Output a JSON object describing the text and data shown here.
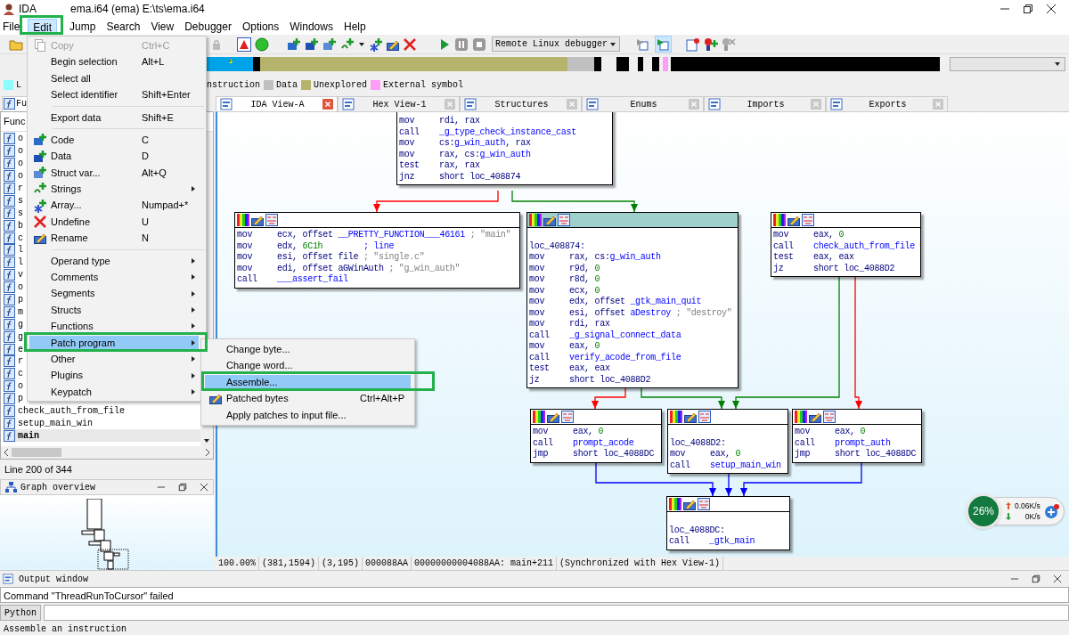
{
  "window": {
    "app": "IDA",
    "title": "ema.i64 (ema) E:\\ts\\ema.i64"
  },
  "menu_bar": [
    {
      "label": "File",
      "selected": false
    },
    {
      "label": "Edit",
      "selected": true
    },
    {
      "label": "Jump",
      "selected": false
    },
    {
      "label": "Search",
      "selected": false
    },
    {
      "label": "View",
      "selected": false
    },
    {
      "label": "Debugger",
      "selected": false
    },
    {
      "label": "Options",
      "selected": false
    },
    {
      "label": "Windows",
      "selected": false
    },
    {
      "label": "Help",
      "selected": false
    }
  ],
  "toolbar": {
    "debugger": "Remote Linux debugger",
    "toggles": [
      {
        "selected": false
      },
      {
        "selected": true
      }
    ]
  },
  "legend": [
    {
      "label": "L",
      "color": "#8cfcfc"
    },
    {
      "label": "nstruction"
    },
    {
      "label": "Data",
      "color": "#c0c0c0"
    },
    {
      "label": "Unexplored",
      "color": "#b5b36c"
    },
    {
      "label": "External symbol",
      "color": "#ff9cf5"
    }
  ],
  "left_panel": {
    "tab": "Fu",
    "column": "Func",
    "line_info": "Line 200 of 344",
    "overview_title": "Graph overview",
    "functions": [
      {
        "name": "o",
        "selected": false
      },
      {
        "name": "o",
        "selected": false
      },
      {
        "name": "o",
        "selected": false
      },
      {
        "name": "o",
        "selected": false
      },
      {
        "name": "r",
        "selected": false
      },
      {
        "name": "s",
        "selected": false
      },
      {
        "name": "s",
        "selected": false
      },
      {
        "name": "b",
        "selected": false
      },
      {
        "name": "c",
        "selected": false
      },
      {
        "name": "l",
        "selected": false
      },
      {
        "name": "l",
        "selected": false
      },
      {
        "name": "v",
        "selected": false
      },
      {
        "name": "o",
        "selected": false
      },
      {
        "name": "p",
        "selected": false
      },
      {
        "name": "m",
        "selected": false
      },
      {
        "name": "g",
        "selected": false
      },
      {
        "name": "g",
        "selected": false
      },
      {
        "name": "e",
        "selected": false
      },
      {
        "name": "r",
        "selected": false
      },
      {
        "name": "c",
        "selected": false
      },
      {
        "name": "o",
        "selected": false
      },
      {
        "name": "p",
        "selected": false
      },
      {
        "name": "check_auth_from_file",
        "selected": false
      },
      {
        "name": "setup_main_win",
        "selected": false
      },
      {
        "name": "main",
        "selected": true
      }
    ]
  },
  "tabs": [
    {
      "label": "IDA View-A",
      "selected": true
    },
    {
      "label": "Hex View-1",
      "selected": false
    },
    {
      "label": "Structures",
      "selected": false
    },
    {
      "label": "Enums",
      "selected": false
    },
    {
      "label": "Imports",
      "selected": false
    },
    {
      "label": "Exports",
      "selected": false
    }
  ],
  "graph": {
    "nodes": [
      {
        "lines": [
          {
            "op": "mov",
            "args": [
              {
                "text": "rdi, rax",
                "kind": "reg"
              }
            ]
          },
          {
            "op": "call",
            "args": [
              {
                "text": "_g_type_check_instance_cast",
                "kind": "name"
              }
            ]
          },
          {
            "op": "mov",
            "args": [
              {
                "text": "cs:",
                "kind": "reg"
              },
              {
                "text": "g_win_auth",
                "kind": "name"
              },
              {
                "text": ", rax",
                "kind": "reg"
              }
            ]
          },
          {
            "op": "mov",
            "args": [
              {
                "text": "rax, cs:",
                "kind": "reg"
              },
              {
                "text": "g_win_auth",
                "kind": "name"
              }
            ]
          },
          {
            "op": "test",
            "args": [
              {
                "text": "rax, rax",
                "kind": "reg"
              }
            ]
          },
          {
            "op": "jnz",
            "args": [
              {
                "text": "short loc_408874",
                "kind": "reg"
              }
            ]
          }
        ]
      },
      {
        "selected": false,
        "lines": [
          {
            "op": "mov",
            "args": [
              {
                "text": "ecx, offset ",
                "kind": "reg"
              },
              {
                "text": "__PRETTY_FUNCTION___46161",
                "kind": "name"
              },
              {
                "text": " ; \"main\"",
                "kind": "comment"
              }
            ]
          },
          {
            "op": "mov",
            "args": [
              {
                "text": "edx, ",
                "kind": "reg"
              },
              {
                "text": "6C1h",
                "kind": "num"
              },
              {
                "text": "        ; line",
                "kind": "name"
              }
            ]
          },
          {
            "op": "mov",
            "args": [
              {
                "text": "esi, offset file ",
                "kind": "reg"
              },
              {
                "text": "; \"single.c\"",
                "kind": "comment"
              }
            ]
          },
          {
            "op": "mov",
            "args": [
              {
                "text": "edi, offset aGWinAuth ",
                "kind": "reg"
              },
              {
                "text": "; \"g_win_auth\"",
                "kind": "comment"
              }
            ]
          },
          {
            "op": "call",
            "args": [
              {
                "text": "___assert_fail",
                "kind": "name"
              }
            ]
          }
        ]
      },
      {
        "selected": true,
        "label": "loc_408874:",
        "lines": [
          {
            "op": "mov",
            "args": [
              {
                "text": "rax, cs:",
                "kind": "reg"
              },
              {
                "text": "g_win_auth",
                "kind": "name"
              }
            ]
          },
          {
            "op": "mov",
            "args": [
              {
                "text": "r9d, ",
                "kind": "reg"
              },
              {
                "text": "0",
                "kind": "num"
              }
            ]
          },
          {
            "op": "mov",
            "args": [
              {
                "text": "r8d, ",
                "kind": "reg"
              },
              {
                "text": "0",
                "kind": "num"
              }
            ]
          },
          {
            "op": "mov",
            "args": [
              {
                "text": "ecx, ",
                "kind": "reg"
              },
              {
                "text": "0",
                "kind": "num"
              }
            ]
          },
          {
            "op": "mov",
            "args": [
              {
                "text": "edx, offset ",
                "kind": "reg"
              },
              {
                "text": "_gtk_main_quit",
                "kind": "name"
              }
            ]
          },
          {
            "op": "mov",
            "args": [
              {
                "text": "esi, offset ",
                "kind": "reg"
              },
              {
                "text": "aDestroy",
                "kind": "name"
              },
              {
                "text": " ; \"destroy\"",
                "kind": "comment"
              }
            ]
          },
          {
            "op": "mov",
            "args": [
              {
                "text": "rdi, rax",
                "kind": "reg"
              }
            ]
          },
          {
            "op": "call",
            "args": [
              {
                "text": "_g_signal_connect_data",
                "kind": "name"
              }
            ]
          },
          {
            "op": "mov",
            "args": [
              {
                "text": "eax, ",
                "kind": "reg"
              },
              {
                "text": "0",
                "kind": "num"
              }
            ]
          },
          {
            "op": "call",
            "args": [
              {
                "text": "verify_acode_from_file",
                "kind": "name"
              }
            ]
          },
          {
            "op": "test",
            "args": [
              {
                "text": "eax, eax",
                "kind": "reg"
              }
            ]
          },
          {
            "op": "jz",
            "args": [
              {
                "text": "short loc_4088D2",
                "kind": "reg"
              }
            ]
          }
        ]
      },
      {
        "selected": false,
        "lines": [
          {
            "op": "mov",
            "args": [
              {
                "text": "eax, ",
                "kind": "reg"
              },
              {
                "text": "0",
                "kind": "num"
              }
            ]
          },
          {
            "op": "call",
            "args": [
              {
                "text": "check_auth_from_file",
                "kind": "name"
              }
            ]
          },
          {
            "op": "test",
            "args": [
              {
                "text": "eax, eax",
                "kind": "reg"
              }
            ]
          },
          {
            "op": "jz",
            "args": [
              {
                "text": "short loc_4088D2",
                "kind": "reg"
              }
            ]
          }
        ]
      },
      {
        "selected": false,
        "lines": [
          {
            "op": "mov",
            "args": [
              {
                "text": "eax, ",
                "kind": "reg"
              },
              {
                "text": "0",
                "kind": "num"
              }
            ]
          },
          {
            "op": "call",
            "args": [
              {
                "text": "prompt_acode",
                "kind": "name"
              }
            ]
          },
          {
            "op": "jmp",
            "args": [
              {
                "text": "short loc_4088DC",
                "kind": "reg"
              }
            ]
          }
        ]
      },
      {
        "selected": false,
        "label": "loc_4088D2:",
        "lines": [
          {
            "op": "mov",
            "args": [
              {
                "text": "eax, ",
                "kind": "reg"
              },
              {
                "text": "0",
                "kind": "num"
              }
            ]
          },
          {
            "op": "call",
            "args": [
              {
                "text": "setup_main_win",
                "kind": "name"
              }
            ]
          }
        ]
      },
      {
        "selected": false,
        "lines": [
          {
            "op": "mov",
            "args": [
              {
                "text": "eax, ",
                "kind": "reg"
              },
              {
                "text": "0",
                "kind": "num"
              }
            ]
          },
          {
            "op": "call",
            "args": [
              {
                "text": "prompt_auth",
                "kind": "name"
              }
            ]
          },
          {
            "op": "jmp",
            "args": [
              {
                "text": "short loc_4088DC",
                "kind": "reg"
              }
            ]
          }
        ]
      },
      {
        "selected": false,
        "label": "loc_4088DC:",
        "lines": [
          {
            "op": "call",
            "args": [
              {
                "text": "_gtk_main",
                "kind": "name"
              }
            ]
          }
        ]
      }
    ]
  },
  "graph_status": [
    "100.00%",
    "(381,1594)",
    "(3,195)",
    "000088AA",
    "00000000004088AA: main+211",
    "(Synchronized with Hex View-1)"
  ],
  "edit_menu": [
    {
      "kind": "item",
      "label": "Copy",
      "shortcut": "Ctrl+C",
      "disabled": true,
      "selected": false,
      "submenu": false
    },
    {
      "kind": "item",
      "label": "Begin selection",
      "shortcut": "Alt+L",
      "disabled": false,
      "selected": false,
      "submenu": false
    },
    {
      "kind": "item",
      "label": "Select all",
      "disabled": false,
      "selected": false,
      "submenu": false
    },
    {
      "kind": "item",
      "label": "Select identifier",
      "shortcut": "Shift+Enter",
      "disabled": false,
      "selected": false,
      "submenu": false
    },
    {
      "kind": "separator"
    },
    {
      "kind": "item",
      "label": "Export data",
      "shortcut": "Shift+E",
      "disabled": false,
      "selected": false,
      "submenu": false
    },
    {
      "kind": "separator"
    },
    {
      "kind": "item",
      "label": "Code",
      "shortcut": "C",
      "disabled": false,
      "selected": false,
      "submenu": false
    },
    {
      "kind": "item",
      "label": "Data",
      "shortcut": "D",
      "disabled": false,
      "selected": false,
      "submenu": false
    },
    {
      "kind": "item",
      "label": "Struct var...",
      "shortcut": "Alt+Q",
      "disabled": false,
      "selected": false,
      "submenu": false
    },
    {
      "kind": "item",
      "label": "Strings",
      "disabled": false,
      "selected": false,
      "submenu": true
    },
    {
      "kind": "item",
      "label": "Array...",
      "shortcut": "Numpad+*",
      "disabled": false,
      "selected": false,
      "submenu": false
    },
    {
      "kind": "item",
      "label": "Undefine",
      "shortcut": "U",
      "disabled": false,
      "selected": false,
      "submenu": false
    },
    {
      "kind": "item",
      "label": "Rename",
      "shortcut": "N",
      "disabled": false,
      "selected": false,
      "submenu": false
    },
    {
      "kind": "separator"
    },
    {
      "kind": "item",
      "label": "Operand type",
      "disabled": false,
      "selected": false,
      "submenu": true
    },
    {
      "kind": "item",
      "label": "Comments",
      "disabled": false,
      "selected": false,
      "submenu": true
    },
    {
      "kind": "item",
      "label": "Segments",
      "disabled": false,
      "selected": false,
      "submenu": true
    },
    {
      "kind": "item",
      "label": "Structs",
      "disabled": false,
      "selected": false,
      "submenu": true
    },
    {
      "kind": "item",
      "label": "Functions",
      "disabled": false,
      "selected": false,
      "submenu": true
    },
    {
      "kind": "item",
      "label": "Patch program",
      "disabled": false,
      "selected": true,
      "submenu": true
    },
    {
      "kind": "item",
      "label": "Other",
      "disabled": false,
      "selected": false,
      "submenu": true
    },
    {
      "kind": "item",
      "label": "Plugins",
      "disabled": false,
      "selected": false,
      "submenu": true
    },
    {
      "kind": "item",
      "label": "Keypatch",
      "disabled": false,
      "selected": false,
      "submenu": true
    }
  ],
  "patch_menu": [
    {
      "label": "Change byte...",
      "selected": false
    },
    {
      "label": "Change word...",
      "selected": false
    },
    {
      "label": "Assemble...",
      "selected": true
    },
    {
      "label": "Patched bytes",
      "shortcut": "Ctrl+Alt+P",
      "selected": false
    },
    {
      "label": "Apply patches to input file...",
      "selected": false
    }
  ],
  "output": {
    "title": "Output window",
    "lines": [
      "Command \"ThreadRunToCursor\" failed"
    ],
    "button": "Python"
  },
  "status_bar": "Assemble an instruction",
  "net_widget": {
    "percent": "26%",
    "up": "0.06K/s",
    "down": "0K/s"
  }
}
